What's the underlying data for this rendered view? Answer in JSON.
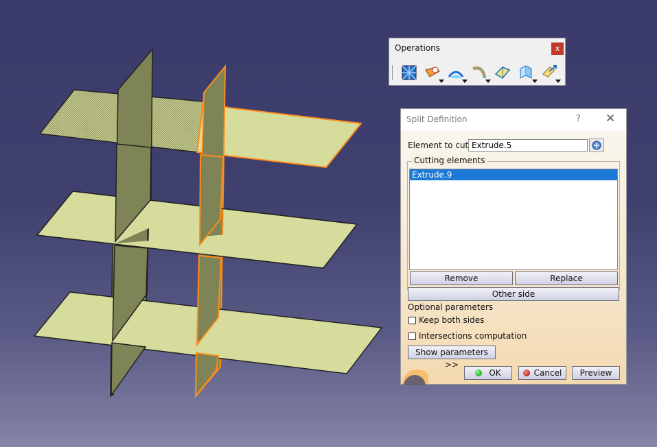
{
  "toolbar": {
    "title": "Operations",
    "close_label": "x",
    "tools": [
      {
        "icon": "join-icon"
      },
      {
        "icon": "healing-icon"
      },
      {
        "icon": "curve-smooth-icon"
      },
      {
        "icon": "untrim-icon"
      },
      {
        "icon": "disassemble-icon"
      },
      {
        "icon": "split-icon"
      },
      {
        "icon": "translate-icon"
      }
    ]
  },
  "dialog": {
    "title": "Split Definition",
    "help_label": "?",
    "close_label": "✕",
    "element_to_cut_label": "Element to cut:",
    "element_to_cut_value": "Extrude.5",
    "cutting_elements_label": "Cutting elements",
    "cutting_elements": [
      "Extrude.9"
    ],
    "remove_label": "Remove",
    "replace_label": "Replace",
    "other_side_label": "Other side",
    "optional_parameters_label": "Optional parameters",
    "keep_both_sides_label": "Keep both sides",
    "keep_both_sides_checked": false,
    "intersections_label": "Intersections computation",
    "intersections_checked": false,
    "show_parameters_label": "Show parameters >>",
    "ok_label": "OK",
    "cancel_label": "Cancel",
    "preview_label": "Preview"
  },
  "colors": {
    "plane_fill": "#d6dc9c",
    "vertical_plane": "#7f8456",
    "highlight": "#ff8c1a"
  }
}
